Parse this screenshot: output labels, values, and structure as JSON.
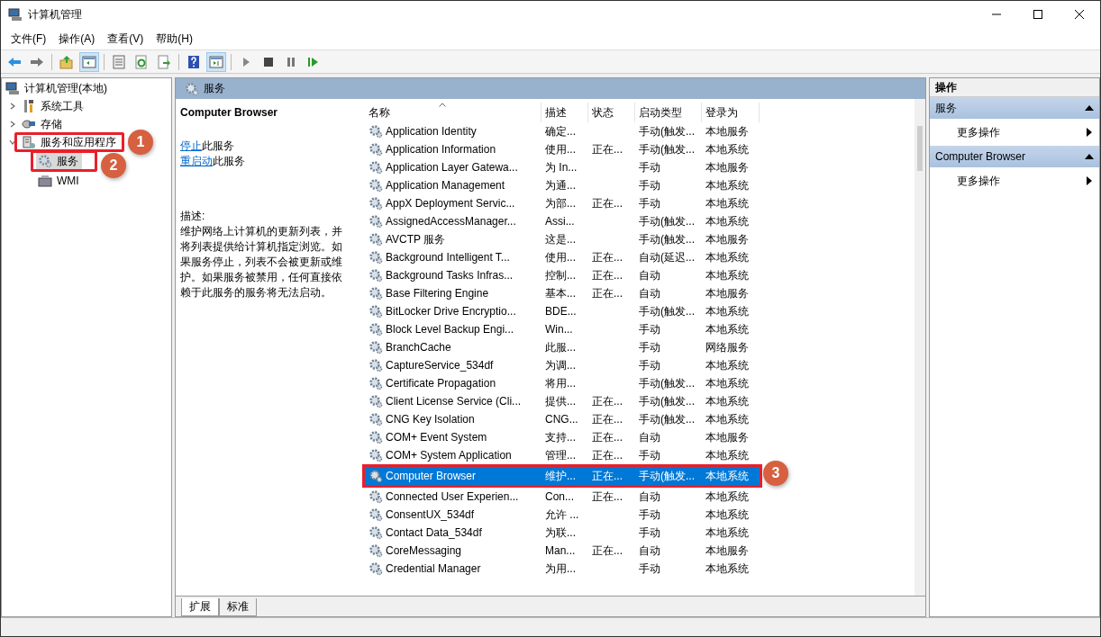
{
  "window": {
    "title": "计算机管理"
  },
  "menu": [
    "文件(F)",
    "操作(A)",
    "查看(V)",
    "帮助(H)"
  ],
  "toolbar": [
    {
      "kind": "back",
      "pressed": false
    },
    {
      "kind": "forward",
      "pressed": false
    },
    {
      "kind": "up",
      "pressed": false
    },
    {
      "kind": "tree",
      "pressed": true
    },
    {
      "kind": "properties",
      "pressed": false
    },
    {
      "kind": "refresh",
      "pressed": false
    },
    {
      "kind": "export",
      "pressed": false
    },
    {
      "kind": "help",
      "pressed": false
    },
    {
      "kind": "actionpane",
      "pressed": true
    },
    {
      "kind": "play",
      "pressed": false
    },
    {
      "kind": "stop",
      "pressed": false
    },
    {
      "kind": "pause",
      "pressed": false
    },
    {
      "kind": "resume",
      "pressed": false
    }
  ],
  "tree": {
    "label": "计算机管理(本地)",
    "children": [
      {
        "label": "系统工具",
        "kind": "tools",
        "expanded": false
      },
      {
        "label": "存储",
        "kind": "storage",
        "expanded": false
      },
      {
        "label": "服务和应用程序",
        "kind": "apps",
        "expanded": true,
        "step": "1",
        "children": [
          {
            "label": "服务",
            "kind": "services",
            "selected": true,
            "step": "2"
          },
          {
            "label": "WMI",
            "kind": "wmi",
            "selected": false
          }
        ]
      }
    ]
  },
  "center": {
    "title": "服务",
    "detail": {
      "name": "Computer Browser",
      "actions": [
        {
          "link": "停止",
          "rest": "此服务"
        },
        {
          "link": "重启动",
          "rest": "此服务"
        }
      ],
      "description_label": "描述:",
      "description": "维护网络上计算机的更新列表，并将列表提供给计算机指定浏览。如果服务停止，列表不会被更新或维护。如果服务被禁用，任何直接依赖于此服务的服务将无法启动。"
    },
    "table": {
      "columns": [
        {
          "label": "名称",
          "sorted": true
        },
        {
          "label": "描述",
          "sorted": false
        },
        {
          "label": "状态",
          "sorted": false
        },
        {
          "label": "启动类型",
          "sorted": false
        },
        {
          "label": "登录为",
          "sorted": false
        }
      ],
      "rows": [
        {
          "name": "Application Identity",
          "description": "确定...",
          "startup": "手动(触发...",
          "logon": "本地服务",
          "selected": false
        },
        {
          "name": "Application Information",
          "description": "使用...",
          "status": "正在...",
          "startup": "手动(触发...",
          "logon": "本地系统",
          "selected": false
        },
        {
          "name": "Application Layer Gatewa...",
          "description": "为 In...",
          "startup": "手动",
          "logon": "本地服务",
          "selected": false
        },
        {
          "name": "Application Management",
          "description": "为通...",
          "startup": "手动",
          "logon": "本地系统",
          "selected": false
        },
        {
          "name": "AppX Deployment Servic...",
          "description": "为部...",
          "status": "正在...",
          "startup": "手动",
          "logon": "本地系统",
          "selected": false
        },
        {
          "name": "AssignedAccessManager...",
          "description": "Assi...",
          "startup": "手动(触发...",
          "logon": "本地系统",
          "selected": false
        },
        {
          "name": "AVCTP 服务",
          "description": "这是...",
          "startup": "手动(触发...",
          "logon": "本地服务",
          "selected": false
        },
        {
          "name": "Background Intelligent T...",
          "description": "使用...",
          "status": "正在...",
          "startup": "自动(延迟...",
          "logon": "本地系统",
          "selected": false
        },
        {
          "name": "Background Tasks Infras...",
          "description": "控制...",
          "status": "正在...",
          "startup": "自动",
          "logon": "本地系统",
          "selected": false
        },
        {
          "name": "Base Filtering Engine",
          "description": "基本...",
          "status": "正在...",
          "startup": "自动",
          "logon": "本地服务",
          "selected": false
        },
        {
          "name": "BitLocker Drive Encryptio...",
          "description": "BDE...",
          "startup": "手动(触发...",
          "logon": "本地系统",
          "selected": false
        },
        {
          "name": "Block Level Backup Engi...",
          "description": "Win...",
          "startup": "手动",
          "logon": "本地系统",
          "selected": false
        },
        {
          "name": "BranchCache",
          "description": "此服...",
          "startup": "手动",
          "logon": "网络服务",
          "selected": false
        },
        {
          "name": "CaptureService_534df",
          "description": "为调...",
          "startup": "手动",
          "logon": "本地系统",
          "selected": false
        },
        {
          "name": "Certificate Propagation",
          "description": "将用...",
          "startup": "手动(触发...",
          "logon": "本地系统",
          "selected": false
        },
        {
          "name": "Client License Service (Cli...",
          "description": "提供...",
          "status": "正在...",
          "startup": "手动(触发...",
          "logon": "本地系统",
          "selected": false
        },
        {
          "name": "CNG Key Isolation",
          "description": "CNG...",
          "status": "正在...",
          "startup": "手动(触发...",
          "logon": "本地系统",
          "selected": false
        },
        {
          "name": "COM+ Event System",
          "description": "支持...",
          "status": "正在...",
          "startup": "自动",
          "logon": "本地服务",
          "selected": false
        },
        {
          "name": "COM+ System Application",
          "description": "管理...",
          "status": "正在...",
          "startup": "手动",
          "logon": "本地系统",
          "selected": false
        },
        {
          "name": "Computer Browser",
          "description": "维护...",
          "status": "正在...",
          "startup": "手动(触发...",
          "logon": "本地系统",
          "selected": true,
          "step": "3"
        },
        {
          "name": "Connected User Experien...",
          "description": "Con...",
          "status": "正在...",
          "startup": "自动",
          "logon": "本地系统",
          "selected": false
        },
        {
          "name": "ConsentUX_534df",
          "description": "允许 ...",
          "startup": "手动",
          "logon": "本地系统",
          "selected": false
        },
        {
          "name": "Contact Data_534df",
          "description": "为联...",
          "startup": "手动",
          "logon": "本地系统",
          "selected": false
        },
        {
          "name": "CoreMessaging",
          "description": "Man...",
          "status": "正在...",
          "startup": "自动",
          "logon": "本地服务",
          "selected": false
        },
        {
          "name": "Credential Manager",
          "description": "为用...",
          "startup": "手动",
          "logon": "本地系统",
          "selected": false
        }
      ]
    },
    "tabs": [
      {
        "label": "扩展",
        "selected": true
      },
      {
        "label": "标准",
        "selected": false
      }
    ]
  },
  "actions_pane": {
    "title": "操作",
    "sections": [
      {
        "title": "服务",
        "expanded": true,
        "items": [
          "更多操作"
        ]
      },
      {
        "title": "Computer Browser",
        "expanded": true,
        "items": [
          "更多操作"
        ]
      }
    ]
  }
}
